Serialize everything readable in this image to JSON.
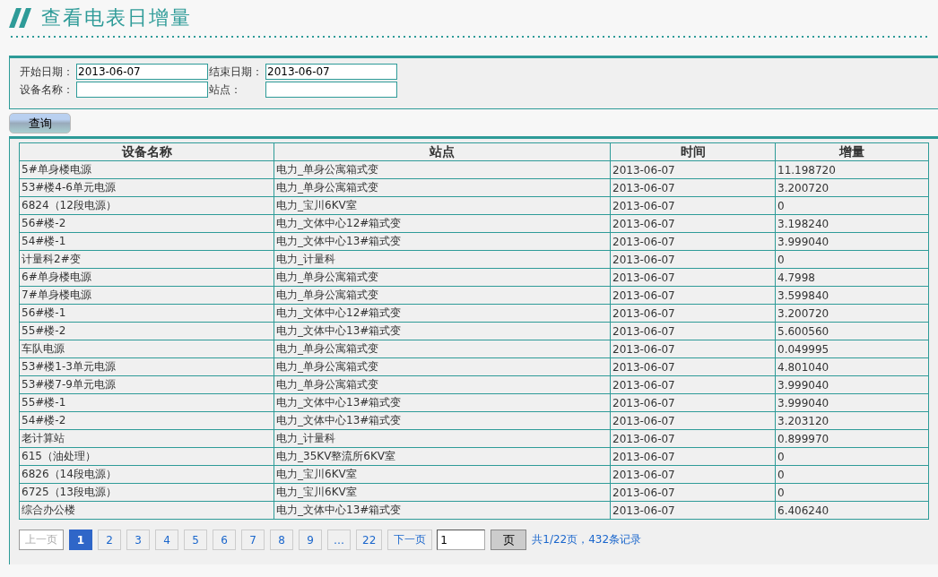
{
  "title": "查看电表日增量",
  "filters": [
    {
      "label": "开始日期：",
      "value": "2013-06-07"
    },
    {
      "label": "结束日期：",
      "value": "2013-06-07"
    },
    {
      "label": "设备名称："
    },
    {
      "label": "站点："
    }
  ],
  "query_button": "查询",
  "table": {
    "columns": [
      "设备名称",
      "站点",
      "时间",
      "增量"
    ],
    "rows": [
      [
        "5#单身楼电源",
        "电力_单身公寓箱式变",
        "2013-06-07",
        "11.198720"
      ],
      [
        "53#楼4-6单元电源",
        "电力_单身公寓箱式变",
        "2013-06-07",
        "3.200720"
      ],
      [
        "6824（12段电源）",
        "电力_宝川6KV室",
        "2013-06-07",
        "0"
      ],
      [
        "56#楼-2",
        "电力_文体中心12#箱式变",
        "2013-06-07",
        "3.198240"
      ],
      [
        "54#楼-1",
        "电力_文体中心13#箱式变",
        "2013-06-07",
        "3.999040"
      ],
      [
        "计量科2#变",
        "电力_计量科",
        "2013-06-07",
        "0"
      ],
      [
        "6#单身楼电源",
        "电力_单身公寓箱式变",
        "2013-06-07",
        "4.7998"
      ],
      [
        "7#单身楼电源",
        "电力_单身公寓箱式变",
        "2013-06-07",
        "3.599840"
      ],
      [
        "56#楼-1",
        "电力_文体中心12#箱式变",
        "2013-06-07",
        "3.200720"
      ],
      [
        "55#楼-2",
        "电力_文体中心13#箱式变",
        "2013-06-07",
        "5.600560"
      ],
      [
        "车队电源",
        "电力_单身公寓箱式变",
        "2013-06-07",
        "0.049995"
      ],
      [
        "53#楼1-3单元电源",
        "电力_单身公寓箱式变",
        "2013-06-07",
        "4.801040"
      ],
      [
        "53#楼7-9单元电源",
        "电力_单身公寓箱式变",
        "2013-06-07",
        "3.999040"
      ],
      [
        "55#楼-1",
        "电力_文体中心13#箱式变",
        "2013-06-07",
        "3.999040"
      ],
      [
        "54#楼-2",
        "电力_文体中心13#箱式变",
        "2013-06-07",
        "3.203120"
      ],
      [
        "老计算站",
        "电力_计量科",
        "2013-06-07",
        "0.899970"
      ],
      [
        "615（油处理）",
        "电力_35KV整流所6KV室",
        "2013-06-07",
        "0"
      ],
      [
        "6826（14段电源）",
        "电力_宝川6KV室",
        "2013-06-07",
        "0"
      ],
      [
        "6725（13段电源）",
        "电力_宝川6KV室",
        "2013-06-07",
        "0"
      ],
      [
        "综合办公楼",
        "电力_文体中心13#箱式变",
        "2013-06-07",
        "6.406240"
      ]
    ]
  },
  "pagination": {
    "prev": {
      "label": "上一页",
      "disabled": true
    },
    "pages": [
      {
        "label": "1",
        "selected": true
      },
      {
        "label": "2",
        "selected": false
      },
      {
        "label": "3",
        "selected": false
      },
      {
        "label": "4",
        "selected": false
      },
      {
        "label": "5",
        "selected": false
      },
      {
        "label": "6",
        "selected": false
      },
      {
        "label": "7",
        "selected": false
      },
      {
        "label": "8",
        "selected": false
      },
      {
        "label": "9",
        "selected": false
      },
      {
        "label": "…",
        "selected": false
      },
      {
        "label": "22",
        "selected": false
      }
    ],
    "next": {
      "label": "下一页",
      "disabled": false
    },
    "page_input": "1",
    "go_button": "页",
    "summary": "共1/22页，432条记录"
  }
}
